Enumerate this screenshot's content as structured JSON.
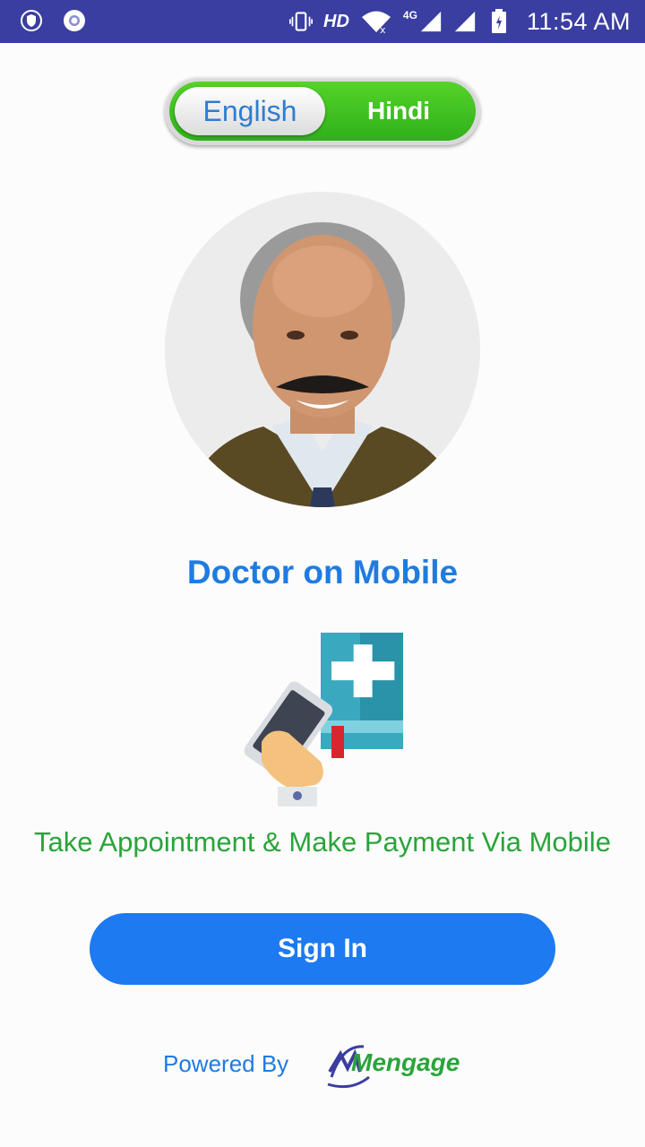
{
  "status_bar": {
    "network": "HD",
    "signal_label": "4G",
    "time": "11:54 AM",
    "icons": [
      "shield-icon",
      "chrome-icon",
      "vibrate-icon",
      "wifi-icon",
      "signal-icon",
      "battery-icon"
    ]
  },
  "language_toggle": {
    "english_label": "English",
    "hindi_label": "Hindi",
    "selected": "English"
  },
  "app": {
    "title": "Doctor on Mobile",
    "tagline": "Take Appointment & Make Payment Via Mobile"
  },
  "signin_label": "Sign In",
  "footer": {
    "powered_by": "Powered By",
    "brand": "Mengage"
  },
  "colors": {
    "status_bar": "#3a3ea0",
    "primary_blue": "#1d7af0",
    "toggle_green": "#3fc023",
    "tagline_green": "#2aa43a"
  }
}
